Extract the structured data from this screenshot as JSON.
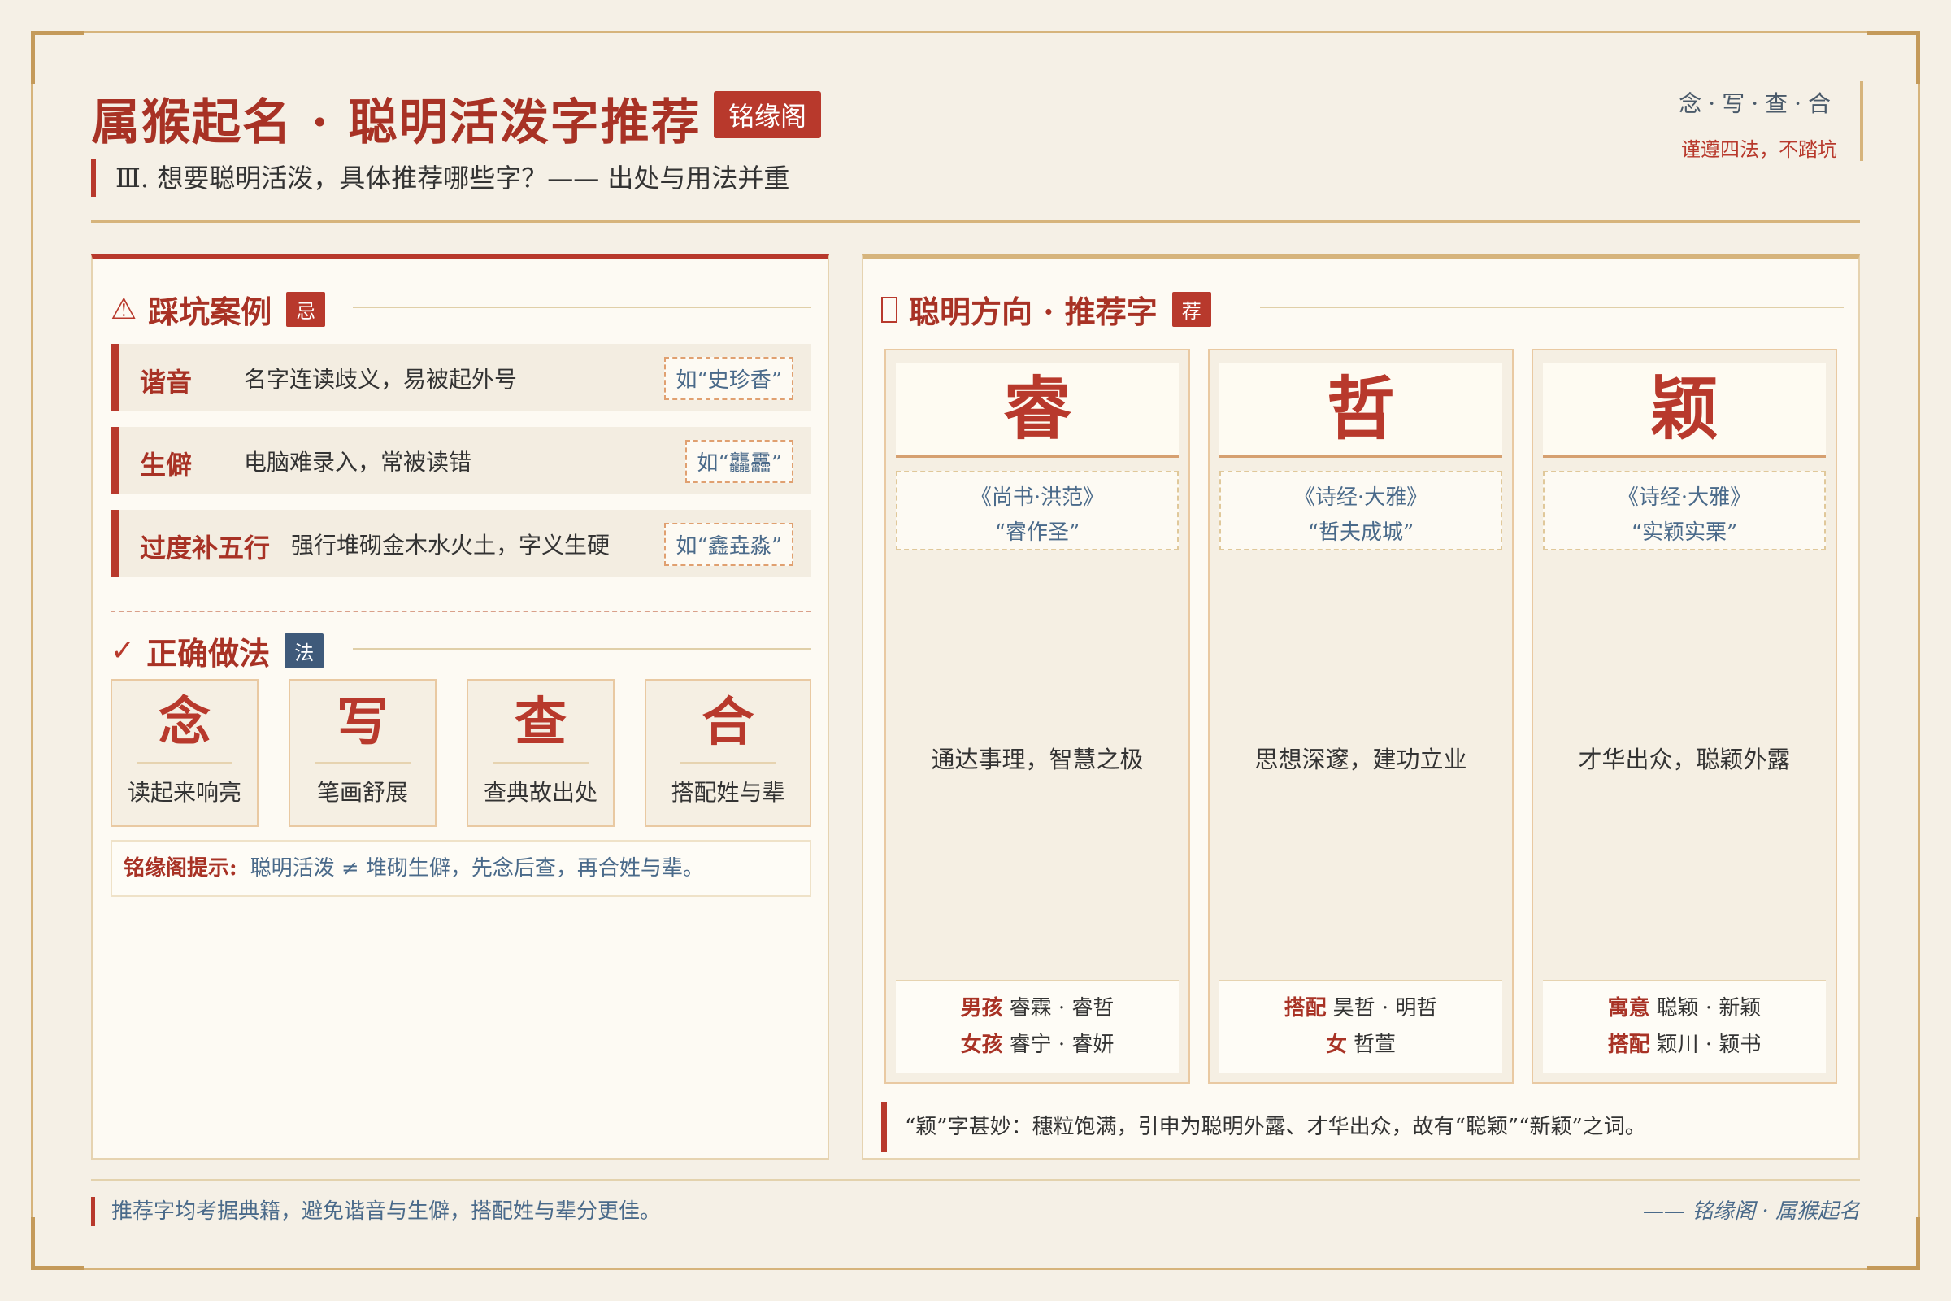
{
  "header": {
    "title": "属猴起名 · 聪明活泼字推荐",
    "tag": "铭缘阁",
    "subtitle": "Ⅲ. 想要聪明活泼，具体推荐哪些字？—— 出处与用法并重",
    "top_right_line1": "念·写·查·合",
    "top_right_line2": "谨遵四法，不踏坑"
  },
  "pitfalls": {
    "title": "踩坑案例",
    "badge": "忌",
    "items": [
      {
        "key": "谐音",
        "desc": "名字连读歧义，易被起外号",
        "example": "如“史珍香”"
      },
      {
        "key": "生僻",
        "desc": "电脑难录入，常被读错",
        "example": "如“龘靐”"
      },
      {
        "key": "过度补五行",
        "desc": "强行堆砌金木水火土，字义生硬",
        "example": "如“鑫垚淼”"
      }
    ]
  },
  "methods": {
    "title": "正确做法",
    "badge": "法",
    "items": [
      {
        "char": "念",
        "desc": "读起来响亮"
      },
      {
        "char": "写",
        "desc": "笔画舒展"
      },
      {
        "char": "查",
        "desc": "查典故出处"
      },
      {
        "char": "合",
        "desc": "搭配姓与辈"
      }
    ],
    "tip_label": "铭缘阁提示:",
    "tip_text": "聪明活泼 ≠ 堆砌生僻，先念后查，再合姓与辈。"
  },
  "recommend": {
    "title": "聪明方向 · 推荐字",
    "badge": "荐",
    "cards": [
      {
        "char": "睿",
        "source": "《尚书·洪范》",
        "quote": "“睿作圣”",
        "meaning": "通达事理，智慧之极",
        "row1_label": "男孩",
        "row1_text": "睿霖 · 睿哲",
        "row2_label": "女孩",
        "row2_text": "睿宁 · 睿妍"
      },
      {
        "char": "哲",
        "source": "《诗经·大雅》",
        "quote": "“哲夫成城”",
        "meaning": "思想深邃，建功立业",
        "row1_label": "搭配",
        "row1_text": "昊哲 · 明哲",
        "row2_label": "女",
        "row2_text": "哲萱"
      },
      {
        "char": "颖",
        "source": "《诗经·大雅》",
        "quote": "“实颖实栗”",
        "meaning": "才华出众，聪颖外露",
        "row1_label": "寓意",
        "row1_text": "聪颖 · 新颖",
        "row2_label": "搭配",
        "row2_text": "颖川 · 颖书"
      }
    ],
    "note": "“颖”字甚妙：穗粒饱满，引申为聪明外露、才华出众，故有“聪颖”“新颖”之词。"
  },
  "footer": {
    "left": "推荐字均考据典籍，避免谐音与生僻，搭配姓与辈分更佳。",
    "right": "—— 铭缘阁 · 属猴起名"
  },
  "colors": {
    "accent_red": "#b8392c",
    "gold": "#d6b47c",
    "badge_blue": "#3f5a7a",
    "background": "#f5f0e6"
  },
  "icons": {
    "pitfalls": "warning-icon",
    "methods": "check-icon",
    "recommend": "missing-glyph-icon"
  }
}
